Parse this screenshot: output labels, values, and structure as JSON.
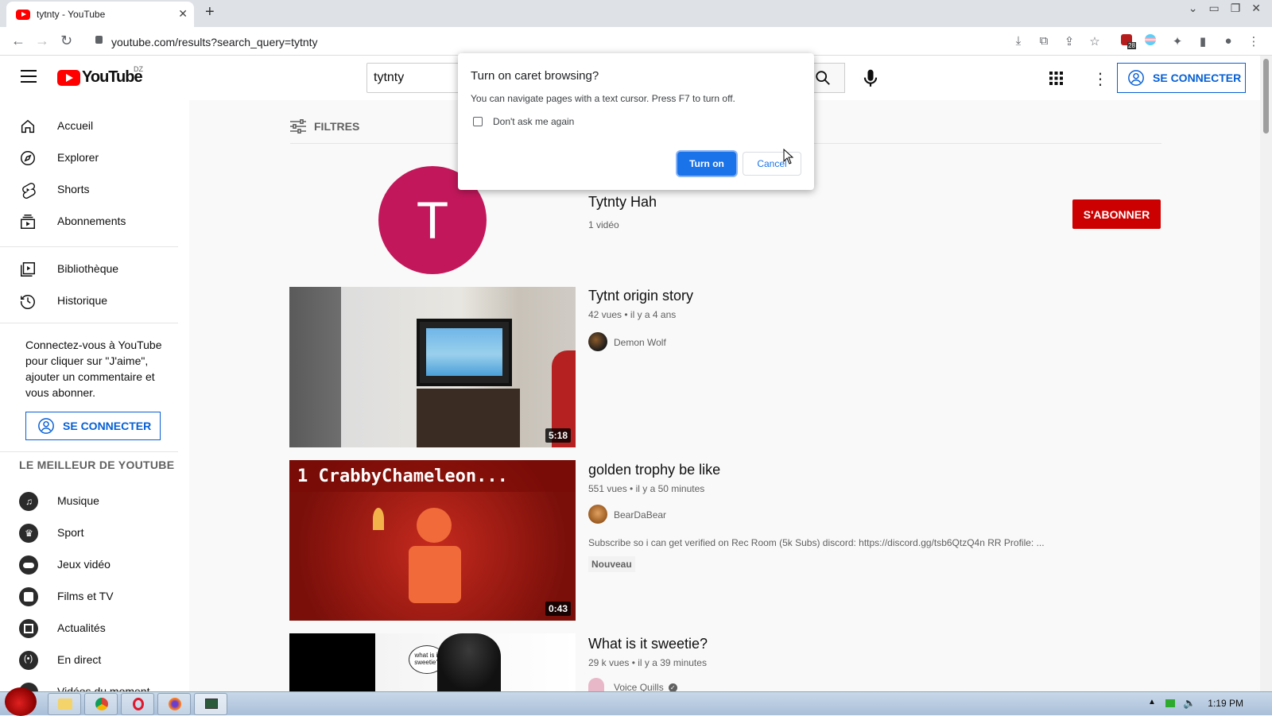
{
  "browser": {
    "tab_title": "tytnty - YouTube",
    "url": "youtube.com/results?search_query=tytnty",
    "ext_badge": "28"
  },
  "header": {
    "logo_text": "YouTube",
    "country_code": "DZ",
    "search_value": "tytnty",
    "signin_label": "SE CONNECTER"
  },
  "sidebar": {
    "items": [
      {
        "label": "Accueil",
        "icon": "home-icon"
      },
      {
        "label": "Explorer",
        "icon": "compass-icon"
      },
      {
        "label": "Shorts",
        "icon": "shorts-icon"
      },
      {
        "label": "Abonnements",
        "icon": "subscriptions-icon"
      },
      {
        "label": "Bibliothèque",
        "icon": "library-icon"
      },
      {
        "label": "Historique",
        "icon": "history-icon"
      }
    ],
    "signin_text": "Connectez-vous à YouTube pour cliquer sur \"J'aime\", ajouter un commentaire et vous abonner.",
    "signin_label": "SE CONNECTER",
    "best_header": "LE MEILLEUR DE YOUTUBE",
    "categories": [
      {
        "label": "Musique",
        "icon": "music-icon"
      },
      {
        "label": "Sport",
        "icon": "trophy-icon"
      },
      {
        "label": "Jeux vidéo",
        "icon": "gamepad-icon"
      },
      {
        "label": "Films et TV",
        "icon": "film-icon"
      },
      {
        "label": "Actualités",
        "icon": "news-icon"
      },
      {
        "label": "En direct",
        "icon": "live-icon"
      },
      {
        "label": "Vidéos du moment",
        "icon": "trending-icon"
      }
    ]
  },
  "main": {
    "filters_label": "FILTRES",
    "channel": {
      "avatar_letter": "T",
      "name": "Tytnty Hah",
      "video_count": "1 vidéo",
      "subscribe_label": "S'ABONNER",
      "avatar_color": "#c2185b"
    },
    "videos": [
      {
        "title": "Tytnt origin story",
        "meta": "42 vues • il y a 4 ans",
        "channel": "Demon Wolf",
        "duration": "5:18",
        "description": "",
        "badge": ""
      },
      {
        "title": "golden trophy be like",
        "meta": "551 vues • il y a 50 minutes",
        "channel": "BearDaBear",
        "duration": "0:43",
        "description": "Subscribe so i can get verified on Rec Room (5k Subs) discord: https://discord.gg/tsb6QtzQ4n RR Profile: ...",
        "badge": "Nouveau",
        "thumb_text": "1 CrabbyChameleon..."
      },
      {
        "title": "What is it sweetie?",
        "meta": "29 k vues • il y a 39 minutes",
        "channel": "Voice Quills",
        "duration": "",
        "description": "",
        "badge": "",
        "thumb_text": "what is it sweetie?"
      }
    ]
  },
  "dialog": {
    "title": "Turn on caret browsing?",
    "message": "You can navigate pages with a text cursor. Press F7 to turn off.",
    "checkbox_label": "Don't ask me again",
    "turn_on_label": "Turn on",
    "cancel_label": "Cancel"
  },
  "taskbar": {
    "clock": "1:19 PM"
  },
  "colors": {
    "accent": "#065fd4",
    "brand_red": "#ff0000",
    "subscribe_red": "#cc0000",
    "dialog_button": "#1a73e8"
  }
}
